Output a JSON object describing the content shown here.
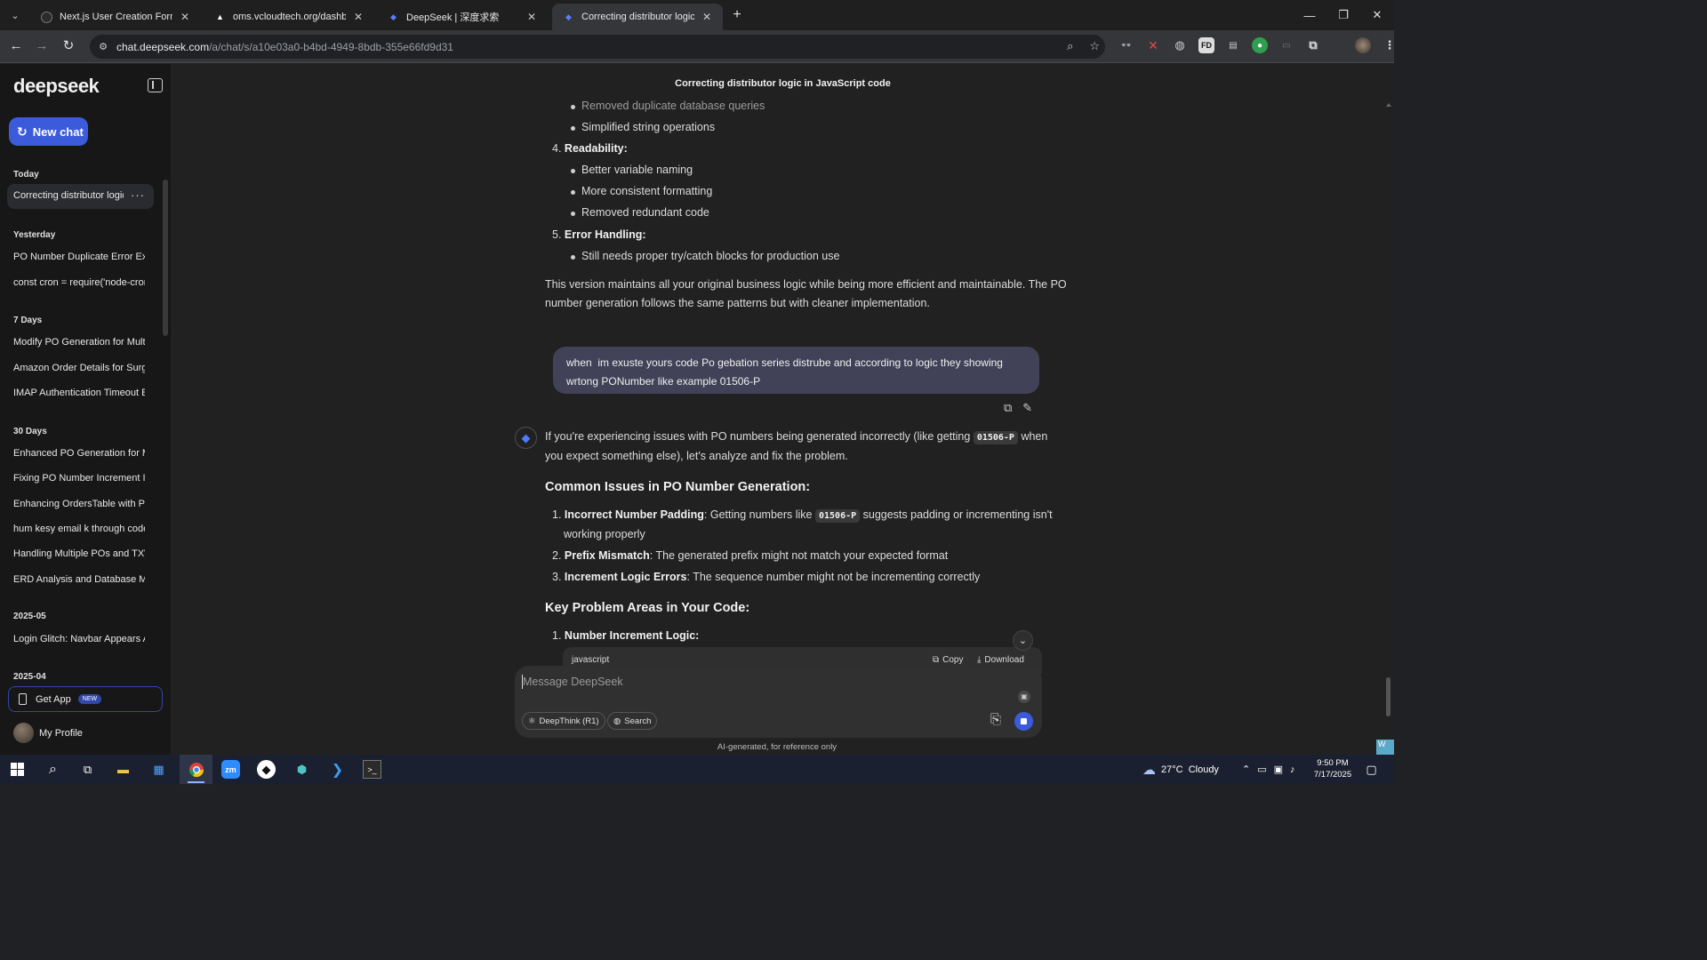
{
  "browser": {
    "tabs": [
      {
        "title": "Next.js User Creation Form",
        "icon": "github-icon"
      },
      {
        "title": "oms.vcloudtech.org/dashboard",
        "icon": "vercel-icon"
      },
      {
        "title": "DeepSeek | 深度求索",
        "icon": "deepseek-icon"
      },
      {
        "title": "Correcting distributor logic in Ja",
        "icon": "deepseek-icon",
        "active": true
      }
    ],
    "url_host": "chat.deepseek.com",
    "url_path": "/a/chat/s/a10e03a0-b4bd-4949-8bdb-355e66fd9d31",
    "ext_fd": "FD"
  },
  "sidebar": {
    "logo": "deepseek",
    "new_chat": "New chat",
    "groups": {
      "today": "Today",
      "yesterday": "Yesterday",
      "seven": "7 Days",
      "thirty": "30 Days",
      "may": "2025-05",
      "apr": "2025-04"
    },
    "active_item": "Correcting distributor logic in JavaScript code",
    "items": [
      "PO Number Duplicate Error Explained",
      "const cron = require('node-cron');",
      "Modify PO Generation for Multiple",
      "Amazon Order Details for Surge",
      "IMAP Authentication Timeout Error",
      "Enhanced PO Generation for Multiple",
      "Fixing PO Number Increment Issue",
      "Enhancing OrdersTable with Product",
      "hum kesy email k through code",
      "Handling Multiple POs and TXW",
      "ERD Analysis and Database Model",
      "Login Glitch: Navbar Appears Above"
    ],
    "get_app": "Get App",
    "badge_new": "NEW",
    "profile": "My Profile"
  },
  "chat": {
    "title": "Correcting distributor logic in JavaScript code",
    "prev": {
      "b1": "Removed duplicate database queries",
      "b2": "Simplified string operations",
      "n4_num": "4.",
      "n4": "Readability:",
      "b3": "Better variable naming",
      "b4": "More consistent formatting",
      "b5": "Removed redundant code",
      "n5_num": "5.",
      "n5": "Error Handling:",
      "b6": "Still needs proper try/catch blocks for production use",
      "p1": "This version maintains all your original business logic while being more efficient and maintainable. The PO",
      "p2": "number generation follows the same patterns but with cleaner implementation."
    },
    "user_msg_l1": "when  im exuste yours code Po gebation series distrube and according to logic they showing",
    "user_msg_l2": "wrtong PONumber like example 01506-P",
    "reply": {
      "intro_a": "If you're experiencing issues with PO numbers being generated incorrectly (like getting",
      "code1": "01506-P",
      "intro_b": "when",
      "intro_c": "you expect something else), let's analyze and fix the problem.",
      "h1": "Common Issues in PO Number Generation:",
      "i1_num": "1.",
      "i1_b": "Incorrect Number Padding",
      "i1_a": ": Getting numbers like",
      "i1_code": "01506-P",
      "i1_c": "suggests padding or incrementing isn't",
      "i1_d": "working properly",
      "i2_num": "2.",
      "i2_b": "Prefix Mismatch",
      "i2_t": ": The generated prefix might not match your expected format",
      "i3_num": "3.",
      "i3_b": "Increment Logic Errors",
      "i3_t": ": The sequence number might not be incrementing correctly",
      "h2": "Key Problem Areas in Your Code:",
      "k1_num": "1.",
      "k1": "Number Increment Logic:",
      "code_lang": "javascript",
      "copy": "Copy",
      "download": "Download"
    },
    "composer": {
      "placeholder": "Message DeepSeek",
      "deepthink": "DeepThink (R1)",
      "search": "Search"
    },
    "disclaimer": "AI-generated, for reference only",
    "corner": "W"
  },
  "taskbar": {
    "weather": "27°C  Cloudy",
    "time": "9:50 PM",
    "date": "7/17/2025"
  }
}
